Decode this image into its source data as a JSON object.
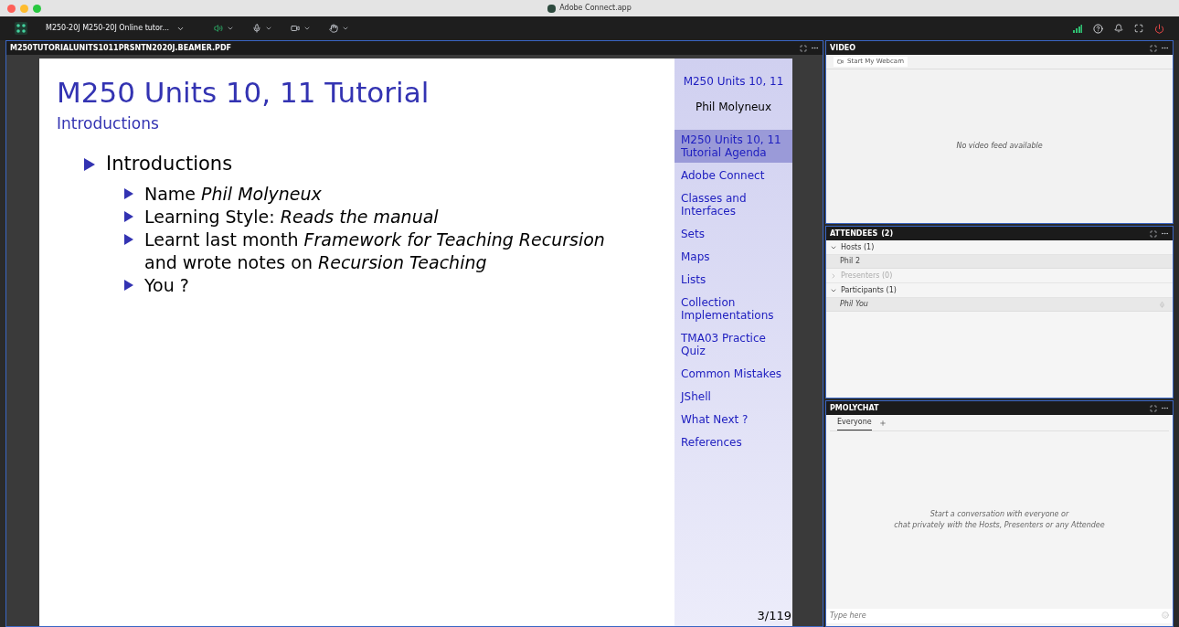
{
  "window": {
    "title": "Adobe Connect.app"
  },
  "toolbar": {
    "meeting_title": "M250-20J M250-20J Online tutor...",
    "speaker_on": true
  },
  "share_pod": {
    "title": "M250TUTORIALUNITS1011PRSNTN2020J.BEAMER.PDF",
    "slide": {
      "title": "M250 Units 10, 11 Tutorial",
      "subtitle": "Introductions",
      "bullets": [
        {
          "text": "Introductions",
          "children": [
            {
              "text": "Name *Phil Molyneux*"
            },
            {
              "text": "Learning Style: *Reads the manual*"
            },
            {
              "text": "Learnt last month *Framework for Teaching Recursion* and wrote notes on *Recursion Teaching*"
            },
            {
              "text": "You ?"
            }
          ]
        }
      ],
      "sidebar_title": "M250 Units 10, 11",
      "sidebar_author": "Phil Molyneux",
      "sidebar_items": [
        {
          "label": "M250 Units 10, 11 Tutorial Agenda",
          "selected": true
        },
        {
          "label": "Adobe Connect",
          "selected": false
        },
        {
          "label": "Classes and Interfaces",
          "selected": false
        },
        {
          "label": "Sets",
          "selected": false
        },
        {
          "label": "Maps",
          "selected": false
        },
        {
          "label": "Lists",
          "selected": false
        },
        {
          "label": "Collection Implementations",
          "selected": false
        },
        {
          "label": "TMA03 Practice Quiz",
          "selected": false
        },
        {
          "label": "Common Mistakes",
          "selected": false
        },
        {
          "label": "JShell",
          "selected": false
        },
        {
          "label": "What Next ?",
          "selected": false
        },
        {
          "label": "References",
          "selected": false
        }
      ],
      "page": "3/119"
    }
  },
  "video_pod": {
    "title": "VIDEO",
    "webcam_button": "Start My Webcam",
    "message": "No video feed available"
  },
  "attendees_pod": {
    "title": "ATTENDEES",
    "count": "(2)",
    "groups": [
      {
        "label": "Hosts (1)",
        "expanded": true,
        "disabled": false,
        "members": [
          {
            "name": "Phil 2",
            "italic": false,
            "mic": false
          }
        ]
      },
      {
        "label": "Presenters (0)",
        "expanded": false,
        "disabled": true
      },
      {
        "label": "Participants (1)",
        "expanded": true,
        "disabled": false,
        "members": [
          {
            "name": "Phil You",
            "italic": true,
            "mic": true
          }
        ]
      }
    ]
  },
  "chat_pod": {
    "title": "PMOLYCHAT",
    "tabs": [
      {
        "label": "Everyone",
        "selected": true
      }
    ],
    "message_lines": [
      "Start a conversation with everyone or",
      "chat privately with the Hosts, Presenters or any Attendee"
    ],
    "input": {
      "placeholder": "Type here"
    }
  }
}
